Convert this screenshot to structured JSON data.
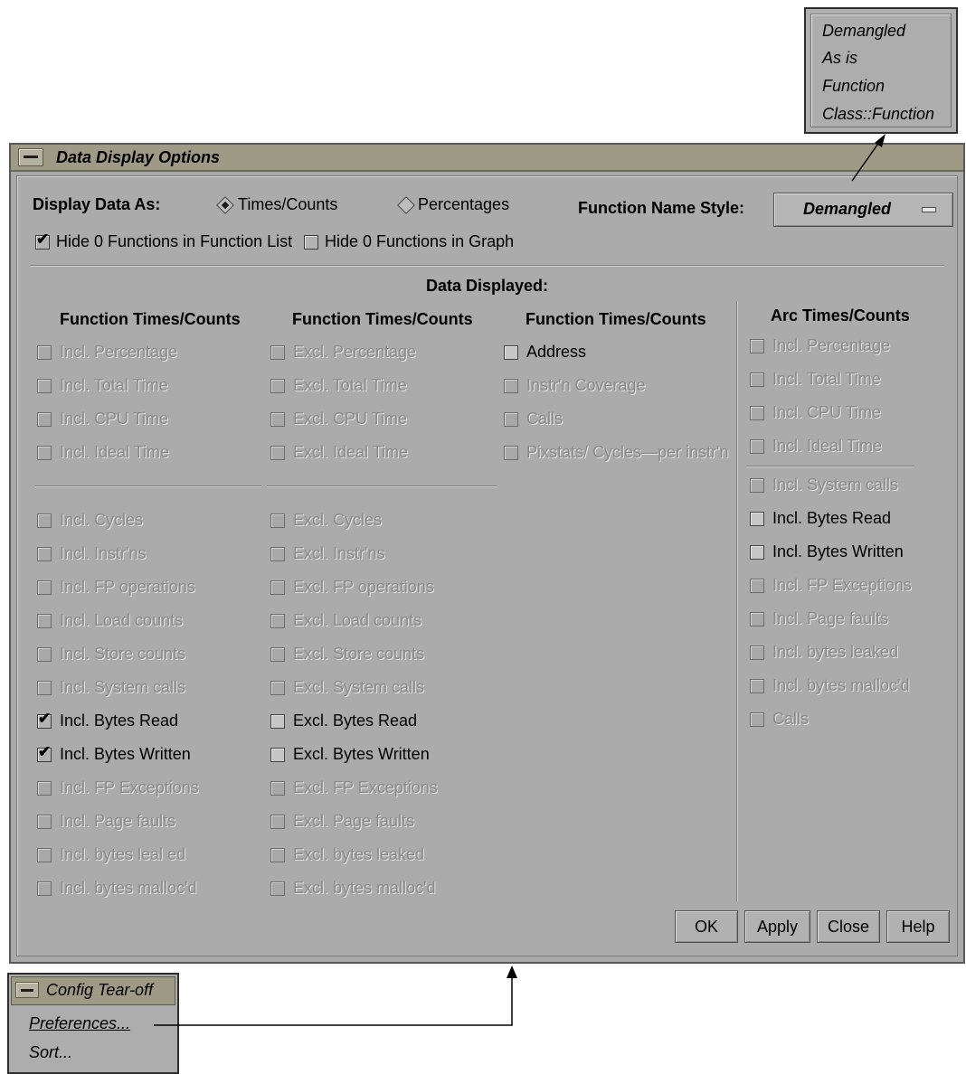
{
  "popup_menu": {
    "items": [
      "Demangled",
      "As is",
      "Function",
      "Class::Function"
    ]
  },
  "window": {
    "title": "Data Display Options",
    "display_as_label": "Display Data As:",
    "radio_times": "Times/Counts",
    "radio_percent": "Percentages",
    "radio_selected": "Times/Counts",
    "fn_style_label": "Function Name Style:",
    "fn_style_value": "Demangled",
    "hide_list_label": "Hide 0 Functions in Function List",
    "hide_list_checked": true,
    "hide_graph_label": "Hide 0 Functions in Graph",
    "hide_graph_checked": false,
    "data_displayed": "Data Displayed:",
    "col1_header": "Function Times/Counts",
    "col2_header": "Function Times/Counts",
    "col3_header": "Function Times/Counts",
    "col4_header": "Arc Times/Counts",
    "col1_top": [
      {
        "label": "Incl. Percentage",
        "state": "disabled"
      },
      {
        "label": "Incl. Total Time",
        "state": "disabled"
      },
      {
        "label": "Incl. CPU Time",
        "state": "disabled"
      },
      {
        "label": "Incl. Ideal Time",
        "state": "disabled"
      }
    ],
    "col1_bottom": [
      {
        "label": "Incl. Cycles",
        "state": "disabled"
      },
      {
        "label": "Incl. Instr'ns",
        "state": "disabled"
      },
      {
        "label": "Incl. FP operations",
        "state": "disabled"
      },
      {
        "label": "Incl. Load counts",
        "state": "disabled"
      },
      {
        "label": "Incl. Store counts",
        "state": "disabled"
      },
      {
        "label": "Incl. System calls",
        "state": "disabled"
      },
      {
        "label": "Incl. Bytes Read",
        "state": "checked"
      },
      {
        "label": "Incl. Bytes Written",
        "state": "checked"
      },
      {
        "label": "Incl. FP Exceptions",
        "state": "disabled"
      },
      {
        "label": "Incl. Page faults",
        "state": "disabled"
      },
      {
        "label": "Incl. bytes leal ed",
        "state": "disabled"
      },
      {
        "label": "Incl. bytes malloc'd",
        "state": "disabled"
      }
    ],
    "col2_top": [
      {
        "label": "Excl. Percentage",
        "state": "disabled"
      },
      {
        "label": "Excl. Total Time",
        "state": "disabled"
      },
      {
        "label": "Excl. CPU Time",
        "state": "disabled"
      },
      {
        "label": "Excl. Ideal Time",
        "state": "disabled"
      }
    ],
    "col2_bottom": [
      {
        "label": "Excl. Cycles",
        "state": "disabled"
      },
      {
        "label": "Excl. Instr'ns",
        "state": "disabled"
      },
      {
        "label": "Excl. FP operations",
        "state": "disabled"
      },
      {
        "label": "Excl. Load counts",
        "state": "disabled"
      },
      {
        "label": "Excl. Store counts",
        "state": "disabled"
      },
      {
        "label": "Excl. System calls",
        "state": "disabled"
      },
      {
        "label": "Excl. Bytes Read",
        "state": "enabled"
      },
      {
        "label": "Excl. Bytes Written",
        "state": "enabled"
      },
      {
        "label": "Excl. FP Exceptions",
        "state": "disabled"
      },
      {
        "label": "Excl. Page faults",
        "state": "disabled"
      },
      {
        "label": "Excl. bytes leaked",
        "state": "disabled"
      },
      {
        "label": "Excl. bytes malloc'd",
        "state": "disabled"
      }
    ],
    "col3": [
      {
        "label": "Address",
        "state": "enabled"
      },
      {
        "label": "Instr'n Coverage",
        "state": "disabled"
      },
      {
        "label": "Calls",
        "state": "disabled"
      },
      {
        "label": "Pixstats/ Cycles—per instr'n",
        "state": "disabled"
      }
    ],
    "col4_top": [
      {
        "label": "Incl. Percentage",
        "state": "disabled"
      },
      {
        "label": "Incl. Total Time",
        "state": "disabled"
      },
      {
        "label": "Incl. CPU Time",
        "state": "disabled"
      },
      {
        "label": "Incl. Ideal Time",
        "state": "disabled"
      }
    ],
    "col4_bottom": [
      {
        "label": "Incl. System calls",
        "state": "disabled"
      },
      {
        "label": "Incl. Bytes Read",
        "state": "enabled"
      },
      {
        "label": "Incl. Bytes Written",
        "state": "enabled"
      },
      {
        "label": "Incl. FP Exceptions",
        "state": "disabled"
      },
      {
        "label": "Incl. Page faults",
        "state": "disabled"
      },
      {
        "label": "Incl. bytes leaked",
        "state": "disabled"
      },
      {
        "label": "Incl. bytes malloc'd",
        "state": "disabled"
      },
      {
        "label": "Calls",
        "state": "disabled"
      }
    ],
    "buttons": {
      "ok": "OK",
      "apply": "Apply",
      "close": "Close",
      "help": "Help"
    }
  },
  "tearoff": {
    "title": "Config Tear-off",
    "items": [
      "Preferences...",
      "Sort..."
    ]
  },
  "colors": {
    "window_bg": "#abababa",
    "title_bar": "#9e9a86",
    "disabled_text": "#8a8a8a"
  }
}
